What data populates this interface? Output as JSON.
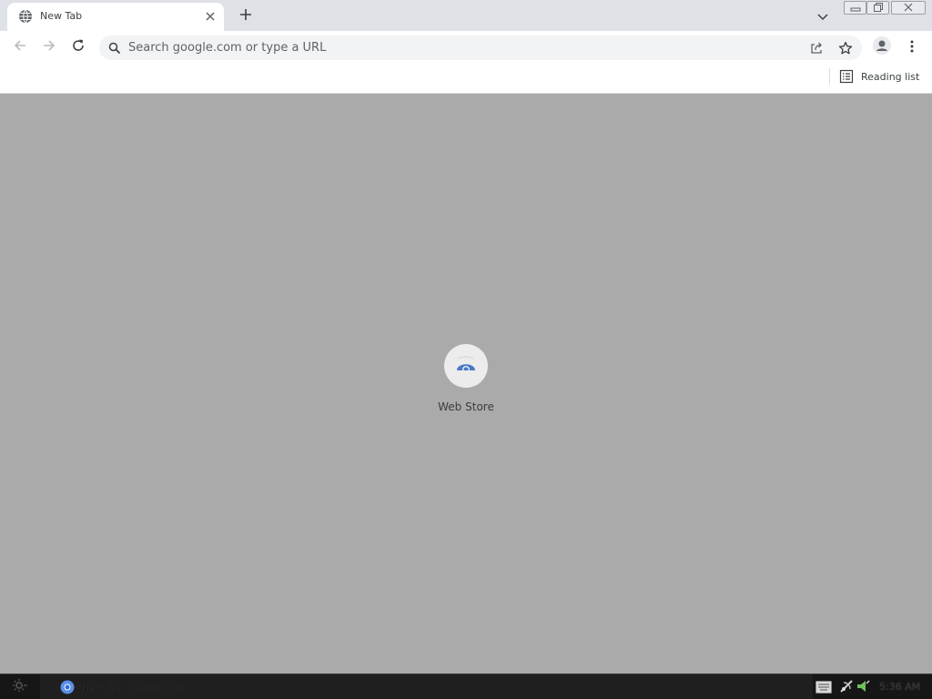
{
  "tab": {
    "title": "New Tab",
    "favicon": "globe-icon"
  },
  "omnibox": {
    "placeholder": "Search google.com or type a URL",
    "value": ""
  },
  "bookmarks_bar": {
    "reading_list_label": "Reading list"
  },
  "ntp": {
    "shortcuts": [
      {
        "label": "Web Store",
        "icon": "web-store-icon"
      }
    ]
  },
  "taskbar": {
    "task_label": "New Tab - Chromium",
    "clock": "5:36 AM"
  },
  "colors": {
    "tabstrip_bg": "#dee1e6",
    "toolbar_bg": "#ffffff",
    "content_bg": "#aaaaaa",
    "taskbar_bg": "#1f1f1f",
    "accent_blue": "#4285f4"
  }
}
